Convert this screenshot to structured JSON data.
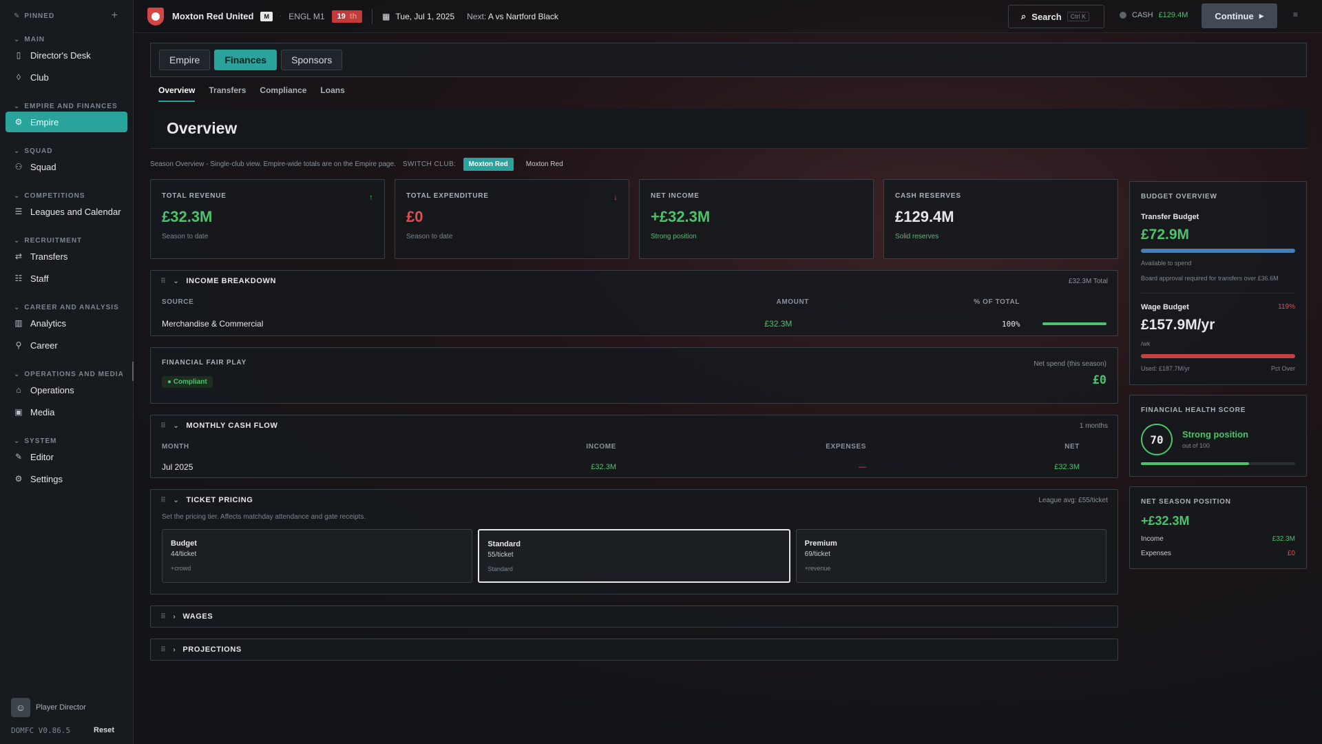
{
  "sidebar": {
    "pinned_label": "PINNED",
    "groups": {
      "main": "MAIN",
      "empire": "EMPIRE AND FINANCES",
      "squad": "SQUAD",
      "competitions": "COMPETITIONS",
      "recruitment": "RECRUITMENT",
      "career": "CAREER AND ANALYSIS",
      "operations": "OPERATIONS AND MEDIA",
      "system": "SYSTEM"
    },
    "items": {
      "directors_desk": "Director's Desk",
      "club": "Club",
      "empire": "Empire",
      "squad": "Squad",
      "leagues": "Leagues and Calendar",
      "transfers": "Transfers",
      "staff": "Staff",
      "analytics": "Analytics",
      "career": "Career",
      "operations": "Operations",
      "media": "Media",
      "editor": "Editor",
      "settings": "Settings"
    },
    "user_name": "Player Director",
    "version": "DOMFC V0.86.5",
    "reset_label": "Reset"
  },
  "topbar": {
    "club_name": "Moxton Red United",
    "badge": "M",
    "league": "ENGL M1",
    "rank": "19",
    "rank_suffix": "th",
    "date": "Tue, Jul 1, 2025",
    "next_label": "Next:",
    "next_value": "A  vs Nartford Black",
    "search_label": "Search",
    "search_shortcut": "Ctrl K",
    "cash_label": "CASH",
    "cash_value": "£129.4M",
    "continue_label": "Continue"
  },
  "tabs": {
    "empire": "Empire",
    "finances": "Finances",
    "sponsors": "Sponsors"
  },
  "subtabs": {
    "overview": "Overview",
    "transfers": "Transfers",
    "compliance": "Compliance",
    "loans": "Loans"
  },
  "page": {
    "title": "Overview",
    "season_note": "Season Overview - Single-club view. Empire-wide totals are on the Empire page.",
    "switch_label": "SWITCH CLUB:",
    "club_active": "Moxton Red",
    "club_other": "Moxton Red"
  },
  "stats": {
    "revenue": {
      "label": "TOTAL REVENUE",
      "value": "£32.3M",
      "sub": "Season to date"
    },
    "expenditure": {
      "label": "TOTAL EXPENDITURE",
      "value": "£0",
      "sub": "Season to date"
    },
    "net": {
      "label": "NET INCOME",
      "value": "+£32.3M",
      "sub": "Strong position"
    },
    "cash": {
      "label": "CASH RESERVES",
      "value": "£129.4M",
      "sub": "Solid reserves"
    }
  },
  "income": {
    "title": "INCOME BREAKDOWN",
    "total": "£32.3M Total",
    "col_source": "SOURCE",
    "col_amount": "AMOUNT",
    "col_pct": "% OF TOTAL",
    "rows": [
      {
        "source": "Merchandise & Commercial",
        "amount": "£32.3M",
        "pct": "100%",
        "share": 1.0
      }
    ]
  },
  "ffp": {
    "title": "FINANCIAL FAIR PLAY",
    "status": "● Compliant",
    "net_label": "Net spend (this season)",
    "net_value": "£0"
  },
  "cashflow": {
    "title": "MONTHLY CASH FLOW",
    "months_note": "1 months",
    "col_month": "MONTH",
    "col_income": "INCOME",
    "col_expenses": "EXPENSES",
    "col_net": "NET",
    "rows": [
      {
        "month": "Jul 2025",
        "income": "£32.3M",
        "expenses": "—",
        "net": "£32.3M"
      }
    ]
  },
  "tickets": {
    "title": "TICKET PRICING",
    "league_avg": "League avg: £55/ticket",
    "desc": "Set the pricing tier. Affects matchday attendance and gate receipts.",
    "tiers": [
      {
        "name": "Budget",
        "price": "44/ticket",
        "note": "+crowd"
      },
      {
        "name": "Standard",
        "price": "55/ticket",
        "note": "Standard"
      },
      {
        "name": "Premium",
        "price": "69/ticket",
        "note": "+revenue"
      }
    ]
  },
  "collapsed": {
    "wages": "WAGES",
    "projections": "PROJECTIONS"
  },
  "budget": {
    "title": "BUDGET OVERVIEW",
    "transfer_label": "Transfer Budget",
    "transfer_value": "£72.9M",
    "transfer_sub": "Available to spend",
    "transfer_note": "Board approval required for transfers over £36.6M",
    "transfer_fill": 1.0,
    "wage_label": "Wage Budget",
    "wage_pct": "119%",
    "wage_value": "£157.9M/yr",
    "wage_sub": "/wk",
    "wage_used": "Used: £187.7M/yr",
    "wage_over": "Pct Over",
    "wage_fill": 1.0
  },
  "health": {
    "title": "FINANCIAL HEALTH SCORE",
    "score": "70",
    "status": "Strong position",
    "out_of": "out of 100",
    "fill": 0.7
  },
  "net_season": {
    "title": "NET SEASON POSITION",
    "value": "+£32.3M",
    "income_label": "Income",
    "income_value": "£32.3M",
    "expenses_label": "Expenses",
    "expenses_value": "£0"
  }
}
